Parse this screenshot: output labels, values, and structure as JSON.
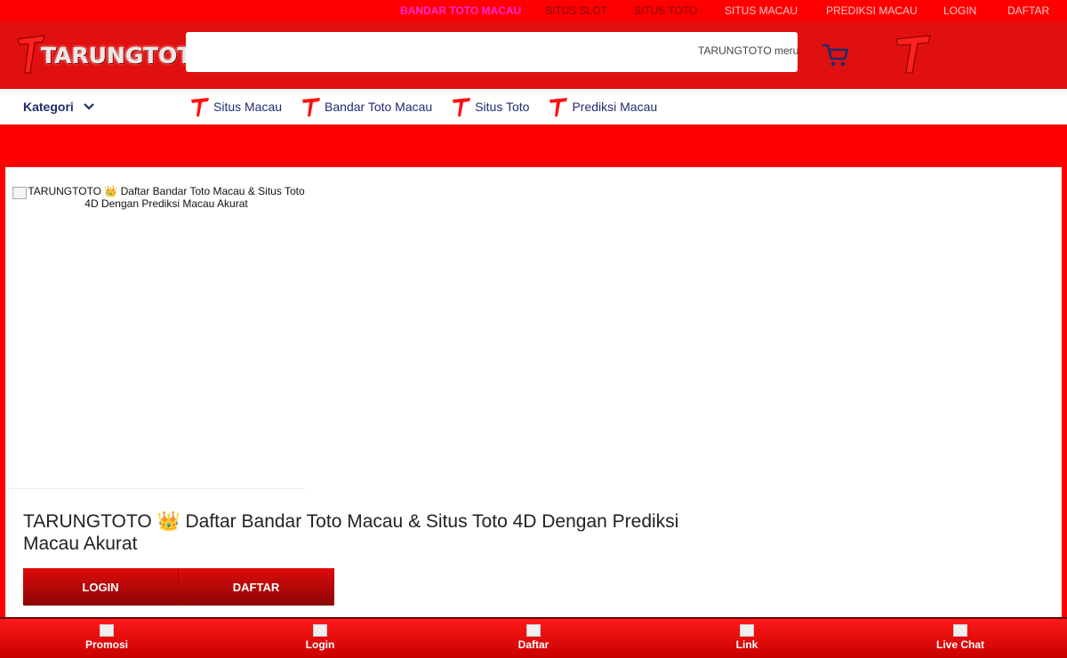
{
  "topnav": [
    {
      "label": "BANDAR TOTO MACAU"
    },
    {
      "label": "SITUS SLOT"
    },
    {
      "label": "SITUS TOTO"
    },
    {
      "label": "SITUS MACAU"
    },
    {
      "label": "PREDIKSI MACAU"
    },
    {
      "label": "LOGIN"
    },
    {
      "label": "DAFTAR"
    }
  ],
  "header": {
    "logo_text": "TARUNGTOTO",
    "search_text": "TARUNGTOTO merup"
  },
  "catbar": {
    "kategori": "Kategori",
    "links": [
      "Situs Macau",
      "Bandar Toto Macau",
      "Situs Toto",
      "Prediksi Macau"
    ]
  },
  "main": {
    "hero_alt": "TARUNGTOTO 👑 Daftar Bandar Toto Macau & Situs Toto 4D Dengan Prediksi Macau Akurat",
    "title": "TARUNGTOTO 👑 Daftar Bandar Toto Macau & Situs Toto 4D Dengan Prediksi Macau Akurat",
    "login_btn": "LOGIN",
    "daftar_btn": "DAFTAR"
  },
  "bottomnav": [
    {
      "label": "Promosi"
    },
    {
      "label": "Login"
    },
    {
      "label": "Daftar"
    },
    {
      "label": "Link"
    },
    {
      "label": "Live Chat"
    }
  ],
  "colors": {
    "primary_red": "#ff0000",
    "header_red": "#e01010",
    "nav_text": "#1f2d6e",
    "active_link": "#ff2bd6"
  }
}
